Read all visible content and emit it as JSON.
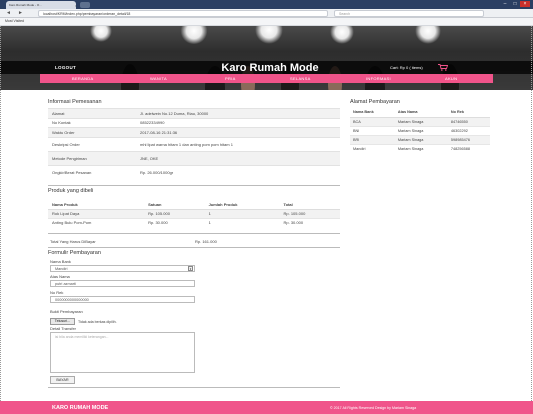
{
  "browser": {
    "tab_title": "Karo Rumah Mode - O...",
    "tab_close": "×",
    "url": "localhost/KRM/index.php/pembayaran/orderan_detail/18",
    "search_placeholder": "Search",
    "bookmark": "Most Visited",
    "back": "◄",
    "forward": "►",
    "win_min": "–",
    "win_max": "□",
    "win_close": "×"
  },
  "header": {
    "logout": "LOGOUT",
    "brand": "Karo Rumah Mode",
    "cart": "Cart: Rp 0 ( items)",
    "menu": [
      "BERANDA",
      "WANITA",
      "PRIA",
      "SELANSA",
      "INFORMASI",
      "AKUN"
    ]
  },
  "order_info": {
    "title": "Informasi Pemesanan",
    "rows": [
      {
        "key": "Alamat",
        "value": "Jl. adelwein No.12 Duma, Riau, 30000"
      },
      {
        "key": "No Kontak",
        "value": "08522334990"
      },
      {
        "key": "Waktu Order",
        "value": "2017-08-16 21:31:36"
      },
      {
        "key": "Deskripsi Order",
        "value": "mhl lipat warna hitam 1 dan anting pom pom hitam 1"
      },
      {
        "key": "Metode Pengiriman",
        "value": "JNE, OKE"
      },
      {
        "key": "Ongkir/Berat Pesanan",
        "value": "Rp. 26.000/1000gr"
      }
    ]
  },
  "bank_info": {
    "title": "Alamat Pembayaran",
    "headers": [
      "Nama Bank",
      "Atas Nama",
      "No Rek"
    ],
    "rows": [
      [
        "BCA",
        "Mariam Sinaga",
        "84746550"
      ],
      [
        "BNI",
        "Mariam Sinaga",
        "46302292"
      ],
      [
        "BRI",
        "Mariam Sinaga",
        "598985476"
      ],
      [
        "Mandiri",
        "Mariam Sinaga",
        "748256588"
      ]
    ]
  },
  "products": {
    "title": "Produk yang dibeli",
    "headers": [
      "Nama Produk",
      "Satuan",
      "Jumlah Produk",
      "Total"
    ],
    "rows": [
      [
        "Rok Lipat Daya",
        "Rp. 105.000",
        "1",
        "Rp. 105.000"
      ],
      [
        "Anting Bulu Pom-Pom",
        "Rp. 30.000",
        "1",
        "Rp. 30.000"
      ]
    ]
  },
  "total": {
    "label": "Total Yang Harus DiBayar",
    "value": "Rp. 161.000"
  },
  "payment_form": {
    "title": "Formulir Pembayaran",
    "bank_label": "Nama Bank",
    "bank_value": "Mandiri",
    "owner_label": "Atas Nama",
    "owner_value": "putri azmarti",
    "account_label": "No Rek",
    "account_value": "0000000000000000",
    "proof_label": "Bukti Pembayaran",
    "file_button": "Telusuri...",
    "file_status": "Tidak ada berkas dipilih.",
    "detail_label": "Detail Transfer",
    "detail_placeholder": "isi bila anda memiliki keterangan...",
    "submit": "BAYAR"
  },
  "footer": {
    "brand": "KARO RUMAH MODE",
    "copyright": "© 2017 All Rights Reserved Design by Mariam Sinaga"
  },
  "colors": {
    "accent": "#f0548a",
    "header_dark": "#2d2d2d"
  }
}
